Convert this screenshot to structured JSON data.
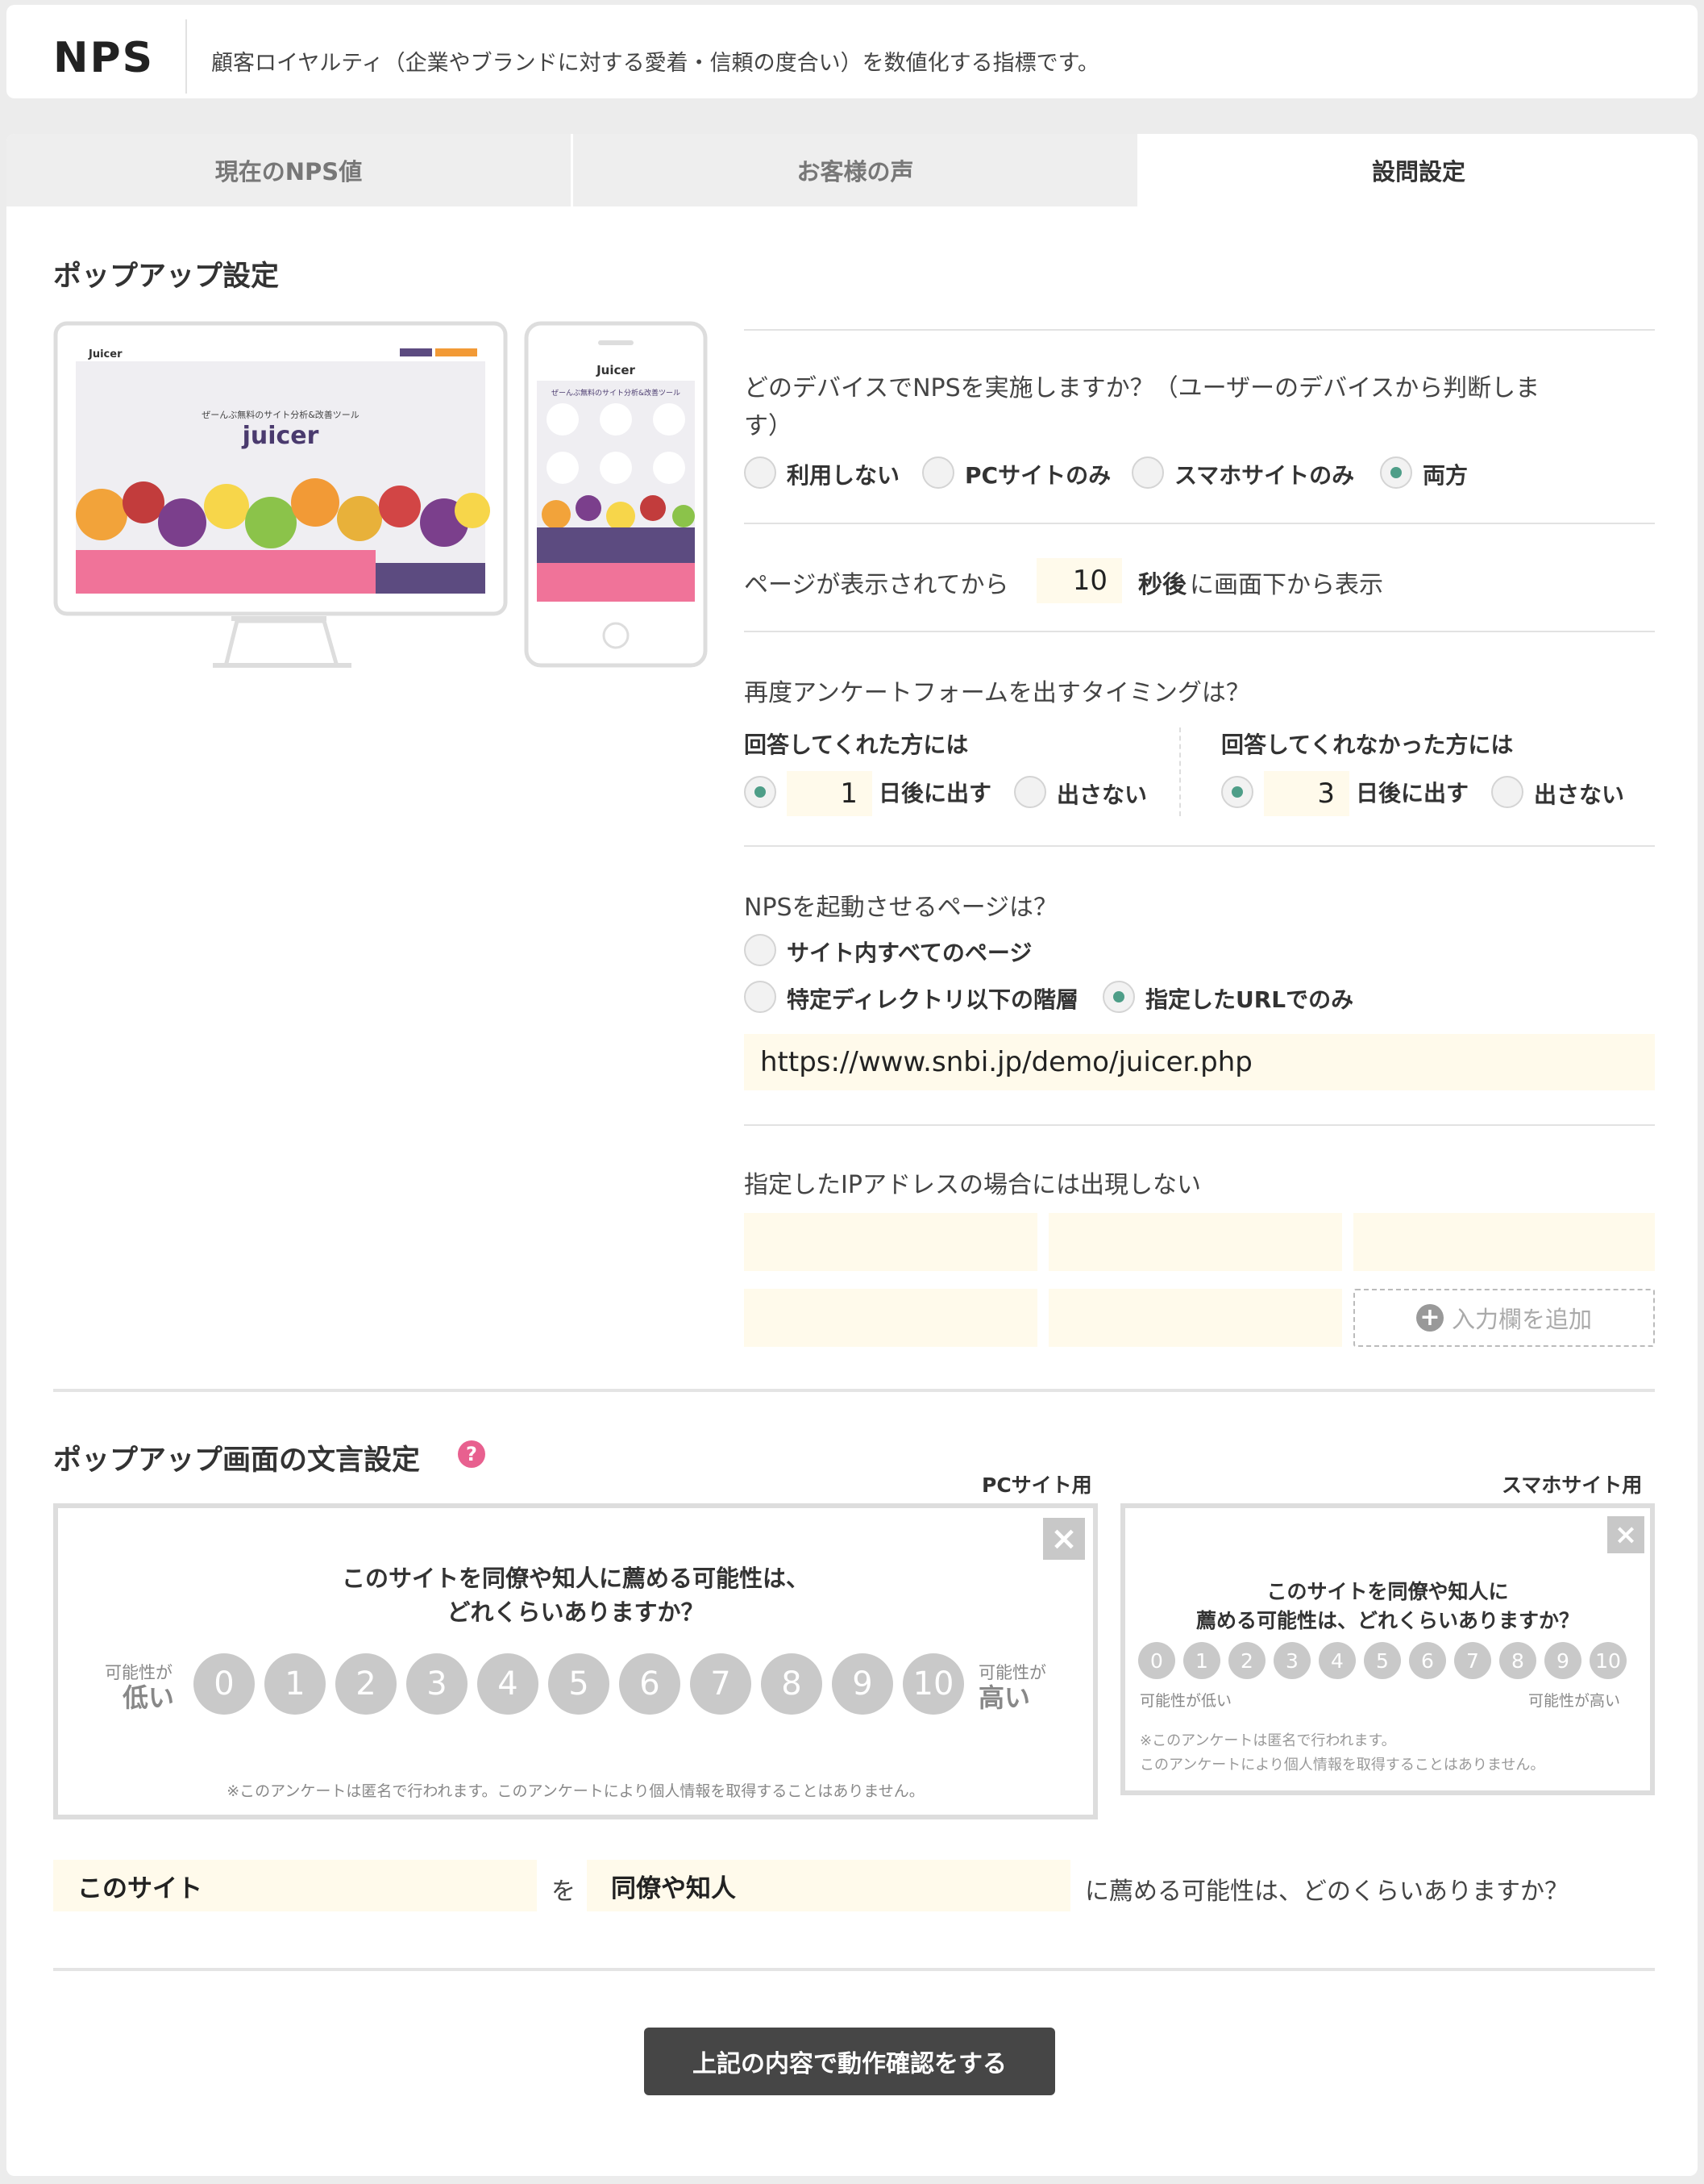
{
  "header": {
    "title": "NPS",
    "description": "顧客ロイヤルティ（企業やブランドに対する愛着・信頼の度合い）を数値化する指標です。"
  },
  "tabs": [
    {
      "label": "現在のNPS値",
      "active": false
    },
    {
      "label": "お客様の声",
      "active": false
    },
    {
      "label": "設問設定",
      "active": true
    }
  ],
  "popup": {
    "title": "ポップアップ設定",
    "device_question": "どのデバイスでNPSを実施しますか？（ユーザーのデバイスから判断しま",
    "device_question_2": "す）",
    "device_options": [
      "利用しない",
      "PCサイトのみ",
      "スマホサイトのみ",
      "両方"
    ],
    "device_selected": "両方",
    "delay_prefix": "ページが表示されてから",
    "delay_value": "10",
    "delay_bold": "秒後",
    "delay_suffix": "に画面下から表示",
    "timing_question": "再度アンケートフォームを出すタイミングは？",
    "answered": {
      "label": "回答してくれた方には",
      "days": "1",
      "days_label": "日後に出す",
      "no_label": "出さない",
      "selected": "days"
    },
    "unanswered": {
      "label": "回答してくれなかった方には",
      "days": "3",
      "days_label": "日後に出す",
      "no_label": "出さない",
      "selected": "days"
    },
    "page_question": "NPSを起動させるページは？",
    "page_options": [
      "サイト内すべてのページ",
      "特定ディレクトリ以下の階層",
      "指定したURLでのみ"
    ],
    "page_selected": "指定したURLでのみ",
    "url_value": "https://www.snbi.jp/demo/juicer.php",
    "ip_label": "指定したIPアドレスの場合には出現しない",
    "add_field_label": "入力欄を追加"
  },
  "preview_images": {
    "desktop": {
      "logo": "Juicer",
      "headline": "ぜーんぶ無料のサイト分析&改善ツール",
      "brand": "juicer"
    },
    "mobile": {
      "logo": "Juicer",
      "headline": "ぜーんぶ無料のサイト分析&改善ツール",
      "brand": "juicer"
    }
  },
  "wording": {
    "title": "ポップアップ画面の文言設定",
    "help_icon": "question-circle-icon",
    "pc_label": "PCサイト用",
    "sp_label": "スマホサイト用",
    "pc_question_1": "このサイトを同僚や知人に薦める可能性は、",
    "pc_question_2": "どれくらいありますか？",
    "sp_question_1": "このサイトを同僚や知人に",
    "sp_question_2": "薦める可能性は、どれくらいありますか？",
    "scores": [
      "0",
      "1",
      "2",
      "3",
      "4",
      "5",
      "6",
      "7",
      "8",
      "9",
      "10"
    ],
    "low_small": "可能性が",
    "low_big": "低い",
    "high_small": "可能性が",
    "high_big": "高い",
    "sp_low": "可能性が低い",
    "sp_high": "可能性が高い",
    "pc_note": "※このアンケートは匿名で行われます。このアンケートにより個人情報を取得することはありません。",
    "sp_note_1": "※このアンケートは匿名で行われます。",
    "sp_note_2": "このアンケートにより個人情報を取得することはありません。",
    "field_site": "このサイト",
    "connector": "を",
    "field_people": "同僚や知人",
    "suffix": "に薦める可能性は、どのくらいありますか？"
  },
  "confirm_button": "上記の内容で動作確認をする",
  "colors": {
    "accent": "#4e9e88",
    "input_bg": "#fffaeb",
    "help": "#e8608f",
    "button": "#464646"
  }
}
